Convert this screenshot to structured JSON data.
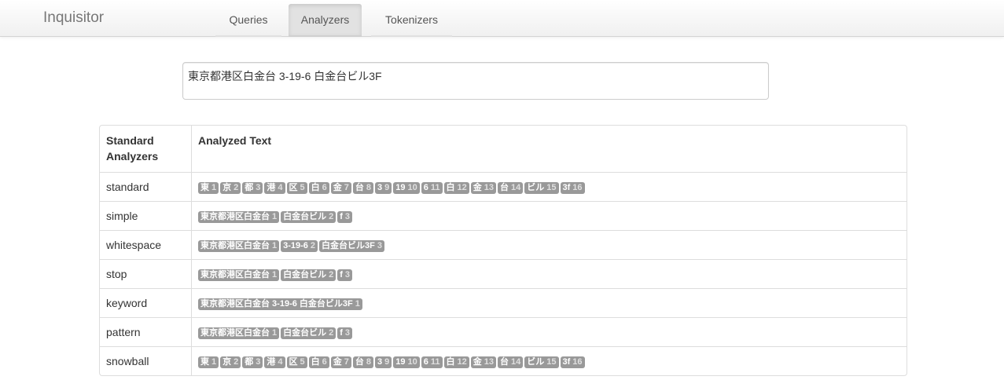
{
  "app": {
    "brand": "Inquisitor"
  },
  "nav": {
    "tabs": [
      {
        "label": "Queries",
        "active": false
      },
      {
        "label": "Analyzers",
        "active": true
      },
      {
        "label": "Tokenizers",
        "active": false
      }
    ]
  },
  "query": {
    "value": "東京都港区白金台 3-19-6 白金台ビル3F"
  },
  "table": {
    "headers": {
      "analyzers": "Standard Analyzers",
      "analyzed": "Analyzed Text"
    },
    "rows": [
      {
        "name": "standard",
        "tokens": [
          {
            "t": "東",
            "p": "1"
          },
          {
            "t": "京",
            "p": "2"
          },
          {
            "t": "都",
            "p": "3"
          },
          {
            "t": "港",
            "p": "4"
          },
          {
            "t": "区",
            "p": "5"
          },
          {
            "t": "白",
            "p": "6"
          },
          {
            "t": "金",
            "p": "7"
          },
          {
            "t": "台",
            "p": "8"
          },
          {
            "t": "3",
            "p": "9"
          },
          {
            "t": "19",
            "p": "10"
          },
          {
            "t": "6",
            "p": "11"
          },
          {
            "t": "白",
            "p": "12"
          },
          {
            "t": "金",
            "p": "13"
          },
          {
            "t": "台",
            "p": "14"
          },
          {
            "t": "ビル",
            "p": "15"
          },
          {
            "t": "3f",
            "p": "16"
          }
        ]
      },
      {
        "name": "simple",
        "tokens": [
          {
            "t": "東京都港区白金台",
            "p": "1"
          },
          {
            "t": "白金台ビル",
            "p": "2"
          },
          {
            "t": "f",
            "p": "3"
          }
        ]
      },
      {
        "name": "whitespace",
        "tokens": [
          {
            "t": "東京都港区白金台",
            "p": "1"
          },
          {
            "t": "3-19-6",
            "p": "2"
          },
          {
            "t": "白金台ビル3F",
            "p": "3"
          }
        ]
      },
      {
        "name": "stop",
        "tokens": [
          {
            "t": "東京都港区白金台",
            "p": "1"
          },
          {
            "t": "白金台ビル",
            "p": "2"
          },
          {
            "t": "f",
            "p": "3"
          }
        ]
      },
      {
        "name": "keyword",
        "tokens": [
          {
            "t": "東京都港区白金台 3-19-6 白金台ビル3F",
            "p": "1"
          }
        ]
      },
      {
        "name": "pattern",
        "tokens": [
          {
            "t": "東京都港区白金台",
            "p": "1"
          },
          {
            "t": "白金台ビル",
            "p": "2"
          },
          {
            "t": "f",
            "p": "3"
          }
        ]
      },
      {
        "name": "snowball",
        "tokens": [
          {
            "t": "東",
            "p": "1"
          },
          {
            "t": "京",
            "p": "2"
          },
          {
            "t": "都",
            "p": "3"
          },
          {
            "t": "港",
            "p": "4"
          },
          {
            "t": "区",
            "p": "5"
          },
          {
            "t": "白",
            "p": "6"
          },
          {
            "t": "金",
            "p": "7"
          },
          {
            "t": "台",
            "p": "8"
          },
          {
            "t": "3",
            "p": "9"
          },
          {
            "t": "19",
            "p": "10"
          },
          {
            "t": "6",
            "p": "11"
          },
          {
            "t": "白",
            "p": "12"
          },
          {
            "t": "金",
            "p": "13"
          },
          {
            "t": "台",
            "p": "14"
          },
          {
            "t": "ビル",
            "p": "15"
          },
          {
            "t": "3f",
            "p": "16"
          }
        ]
      }
    ]
  },
  "colors": {
    "token_bg": "#999999",
    "token_text": "#ffffff"
  }
}
